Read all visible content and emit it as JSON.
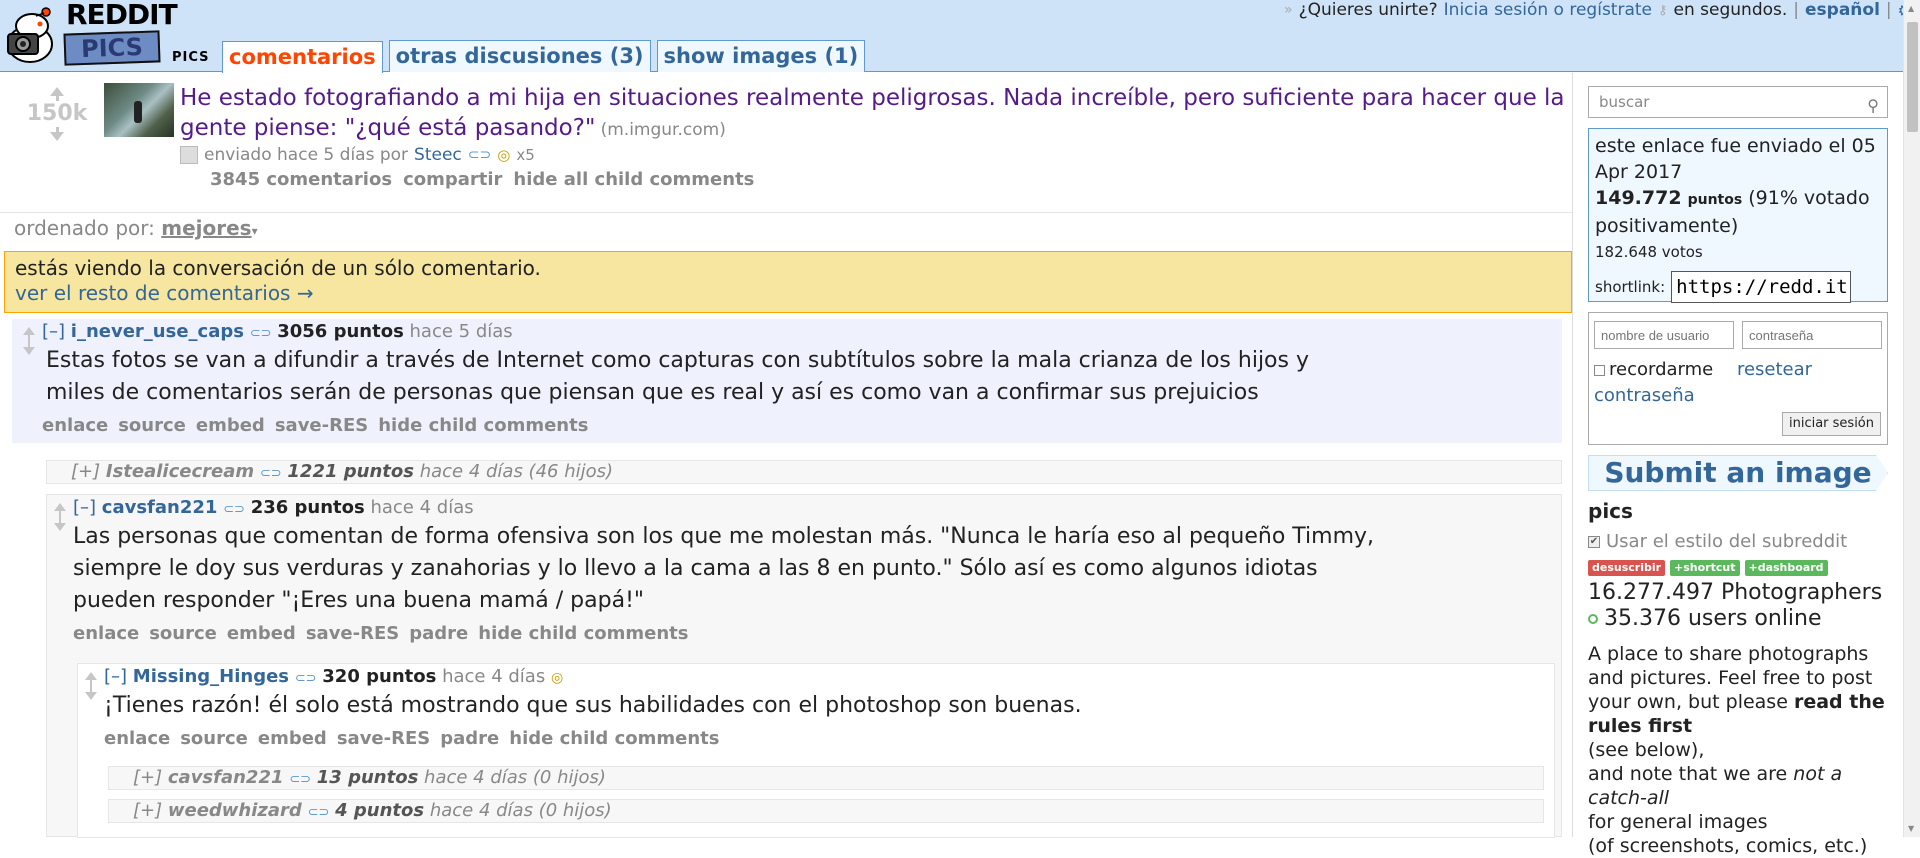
{
  "header": {
    "logo_text": "REDDIT",
    "logo_pics_text": "PICS",
    "subreddit_name": "PICS",
    "tabs": [
      {
        "label": "comentarios",
        "selected": true
      },
      {
        "label": "otras discusiones (3)",
        "selected": false
      },
      {
        "label": "show images (1)",
        "selected": false
      }
    ],
    "userbar": {
      "arrows": "»",
      "prompt": "¿Quieres unirte?",
      "login_link": "Inicia sesión o regístrate",
      "suffix": "en segundos.",
      "separator": "|",
      "language": "español",
      "gear_icon": "gear-icon"
    }
  },
  "post": {
    "score": "150k",
    "title": "He estado fotografiando a mi hija en situaciones realmente peligrosas. Nada increíble, pero suficiente para hacer que la gente piense: \"¿qué está pasando?\"",
    "domain": "(m.imgur.com)",
    "tagline_prefix": "enviado hace 5 días por",
    "author": "Steec",
    "gold_count": "x5",
    "buttons": [
      "3845 comentarios",
      "compartir",
      "hide all child comments"
    ]
  },
  "sort": {
    "label": "ordenado por:",
    "selected": "mejores"
  },
  "infobar": {
    "message": "estás viendo la conversación de un sólo comentario.",
    "link": "ver el resto de comentarios →"
  },
  "comments": [
    {
      "toggle": "[–]",
      "author": "i_never_use_caps",
      "points": "3056 puntos",
      "time": "hace 5 días",
      "body": [
        "Estas fotos se van a difundir a través de Internet como capturas con subtítulos sobre la mala crianza de los hijos y",
        "miles de comentarios serán de personas que piensan que es real y así es como van a confirmar sus prejuicios"
      ],
      "buttons": [
        "enlace",
        "source",
        "embed",
        "save-RES",
        "hide child comments"
      ]
    },
    {
      "toggle": "[+]",
      "author": "Istealicecream",
      "points": "1221 puntos",
      "time": "hace 4 días (46 hijos)"
    },
    {
      "toggle": "[–]",
      "author": "cavsfan221",
      "points": "236 puntos",
      "time": "hace 4 días",
      "body": [
        "Las personas que comentan de forma ofensiva son los que me molestan más. \"Nunca le haría eso al pequeño Timmy,",
        "siempre le doy sus verduras y zanahorias y lo llevo a la cama a las 8 en punto.\" Sólo así es como algunos idiotas",
        "pueden responder \"¡Eres una buena mamá / papá!\""
      ],
      "buttons": [
        "enlace",
        "source",
        "embed",
        "save-RES",
        "padre",
        "hide child comments"
      ]
    },
    {
      "toggle": "[–]",
      "author": "Missing_Hinges",
      "points": "320 puntos",
      "time": "hace 4 días",
      "body": [
        "¡Tienes razón! él solo está mostrando que sus habilidades con el photoshop son buenas."
      ],
      "buttons": [
        "enlace",
        "source",
        "embed",
        "save-RES",
        "padre",
        "hide child comments"
      ]
    },
    {
      "toggle": "[+]",
      "author": "cavsfan221",
      "points": "13 puntos",
      "time": "hace 4 días (0 hijos)"
    },
    {
      "toggle": "[+]",
      "author": "weedwhizard",
      "points": "4 puntos",
      "time": "hace 4 días (0 hijos)"
    }
  ],
  "sidebar": {
    "search_placeholder": "buscar",
    "linkinfo": {
      "date_text": "este enlace fue enviado el 05 Apr 2017",
      "score": "149.772",
      "puntos": "puntos",
      "percent": "(91% votado positivamente)",
      "votes": "182.648 votos",
      "shortlink_label": "shortlink:",
      "shortlink_value": "https://redd.it"
    },
    "login": {
      "username_placeholder": "nombre de usuario",
      "password_placeholder": "contraseña",
      "remember": "recordarme",
      "reset": "resetear contraseña",
      "button": "iniciar sesión"
    },
    "submit_button": "Submit an image",
    "subreddit_title": "pics",
    "style_toggle": "Usar el estilo del subreddit",
    "badges": [
      "desuscribir",
      "+shortcut",
      "+dashboard"
    ],
    "subscribers": "16.277.497 Photographers",
    "online": "35.376 users online",
    "description_lines": [
      "A place to share photographs",
      "and pictures. Feel free to post",
      "your own, but please",
      "read the rules first",
      "(see below),",
      "and note that we are",
      "not a catch-all",
      "for general images",
      "(of screenshots, comics, etc.)"
    ]
  }
}
